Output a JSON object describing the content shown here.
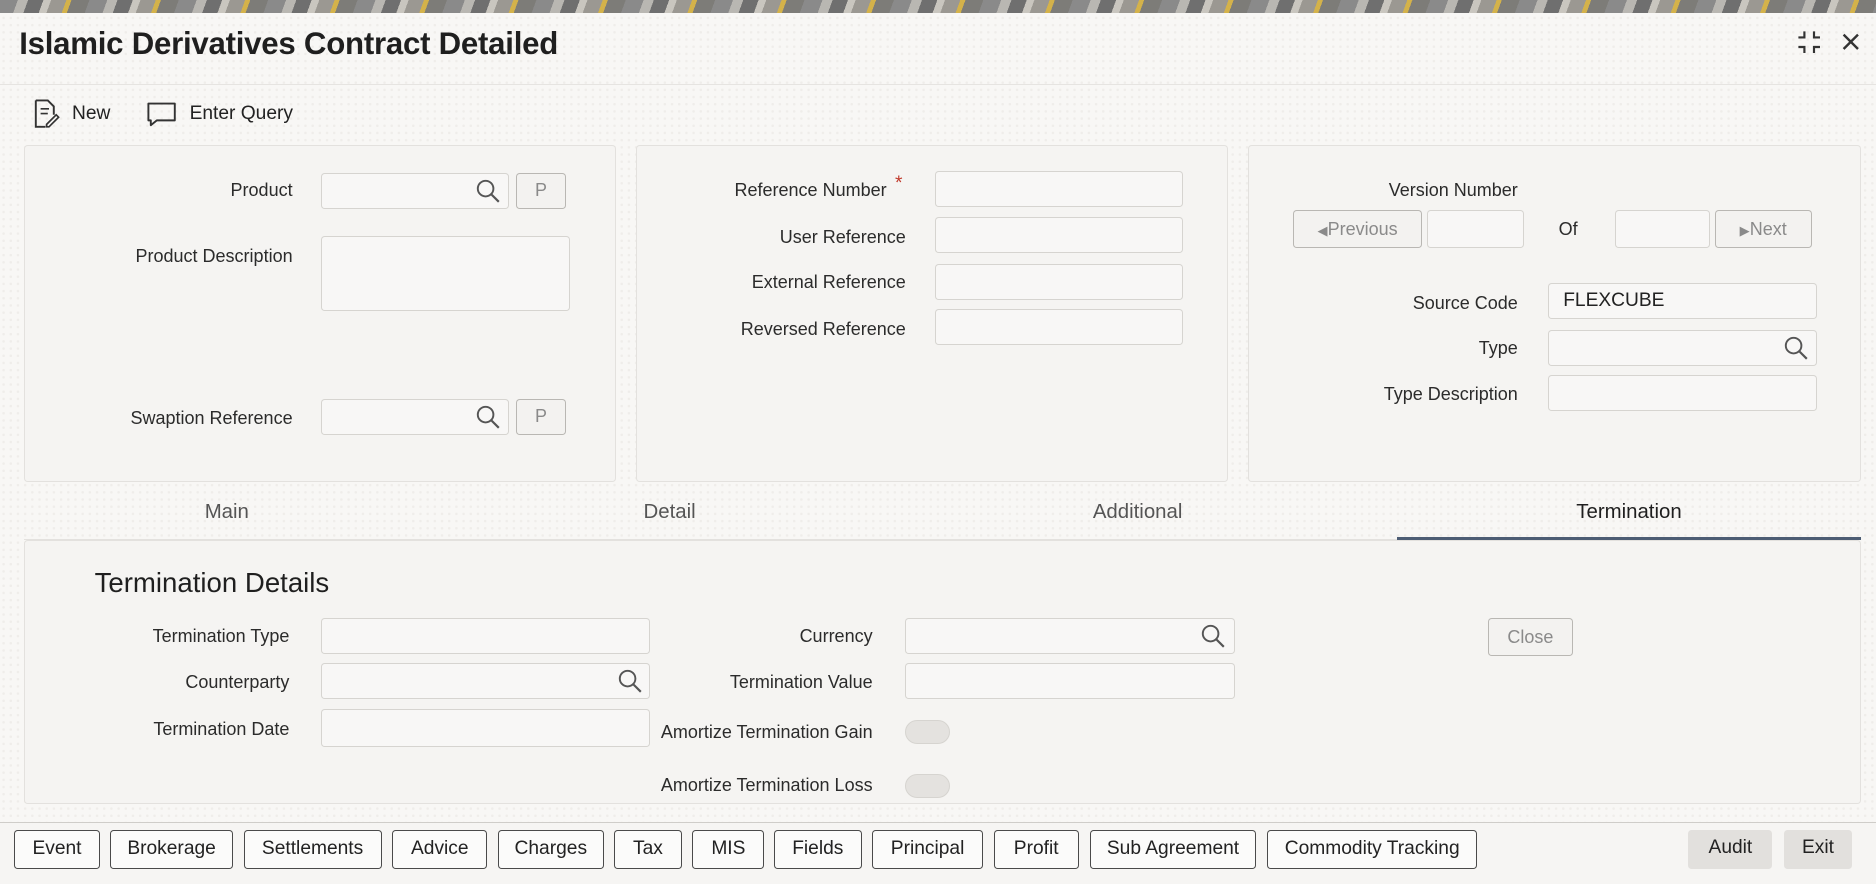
{
  "window": {
    "title": "Islamic Derivatives Contract Detailed"
  },
  "toolbar": {
    "new_label": "New",
    "enter_query_label": "Enter Query"
  },
  "left_panel": {
    "product_label": "Product",
    "product_button": "P",
    "product_description_label": "Product Description",
    "swaption_reference_label": "Swaption Reference",
    "swaption_button": "P"
  },
  "middle_panel": {
    "reference_number_label": "Reference Number",
    "required_mark": "*",
    "user_reference_label": "User Reference",
    "external_reference_label": "External Reference",
    "reversed_reference_label": "Reversed Reference"
  },
  "right_panel": {
    "version_number_label": "Version Number",
    "previous_label": "Previous",
    "of_label": "Of",
    "next_label": "Next",
    "source_code_label": "Source Code",
    "source_code_value": "FLEXCUBE",
    "type_label": "Type",
    "type_description_label": "Type Description"
  },
  "tabs": [
    {
      "label": "Main"
    },
    {
      "label": "Detail"
    },
    {
      "label": "Additional"
    },
    {
      "label": "Termination",
      "active": true
    }
  ],
  "termination": {
    "section_title": "Termination Details",
    "termination_type_label": "Termination Type",
    "counterparty_label": "Counterparty",
    "termination_date_label": "Termination Date",
    "currency_label": "Currency",
    "termination_value_label": "Termination Value",
    "amortize_gain_label": "Amortize Termination Gain",
    "amortize_loss_label": "Amortize Termination Loss",
    "close_label": "Close"
  },
  "bottom_buttons": [
    "Event",
    "Brokerage",
    "Settlements",
    "Advice",
    "Charges",
    "Tax",
    "MIS",
    "Fields",
    "Principal",
    "Profit",
    "Sub Agreement",
    "Commodity Tracking"
  ],
  "footer": {
    "audit_label": "Audit",
    "exit_label": "Exit"
  },
  "icons": {
    "new": "document-edit-icon",
    "enter_query": "speech-bubble-icon",
    "search": "search-icon",
    "maximize": "collapse-icon",
    "close": "close-icon"
  }
}
